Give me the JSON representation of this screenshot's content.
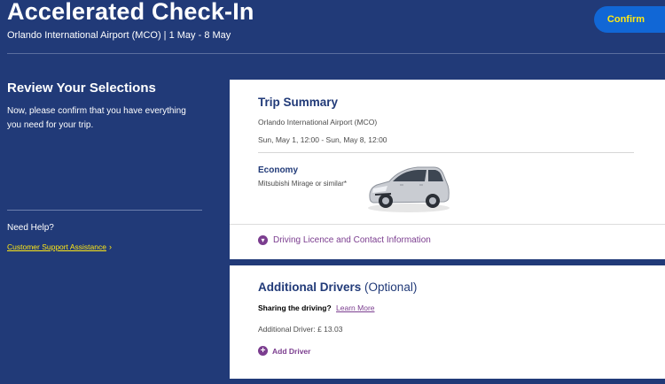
{
  "header": {
    "title": "Accelerated Check-In",
    "subtitle": "Orlando International Airport (MCO) | 1 May - 8 May",
    "confirm_label": "Confirm",
    "colors": {
      "background": "#213a78",
      "confirm_bg": "#1167d6",
      "confirm_text": "#ffe815"
    }
  },
  "sidebar": {
    "review_title": "Review Your Selections",
    "review_text": "Now, please confirm that you have everything you need for your trip.",
    "help_label": "Need Help?",
    "support_link": "Customer Support Assistance",
    "support_chevron": "›"
  },
  "trip_summary": {
    "title": "Trip Summary",
    "location": "Orlando International Airport (MCO)",
    "dates": "Sun, May 1, 12:00 - Sun, May 8, 12:00",
    "car_class": "Economy",
    "car_model": "Mitsubishi Mirage or similar*",
    "car_icon": "car-image",
    "licence_label": "Driving Licence and Contact Information",
    "licence_icon": "chevron-down-icon"
  },
  "additional_drivers": {
    "title": "Additional Drivers",
    "optional": "(Optional)",
    "sharing_label": "Sharing the driving?",
    "learn_more": "Learn More",
    "price": "Additional Driver: £ 13.03",
    "add_label": "Add Driver",
    "add_icon": "plus-icon"
  }
}
